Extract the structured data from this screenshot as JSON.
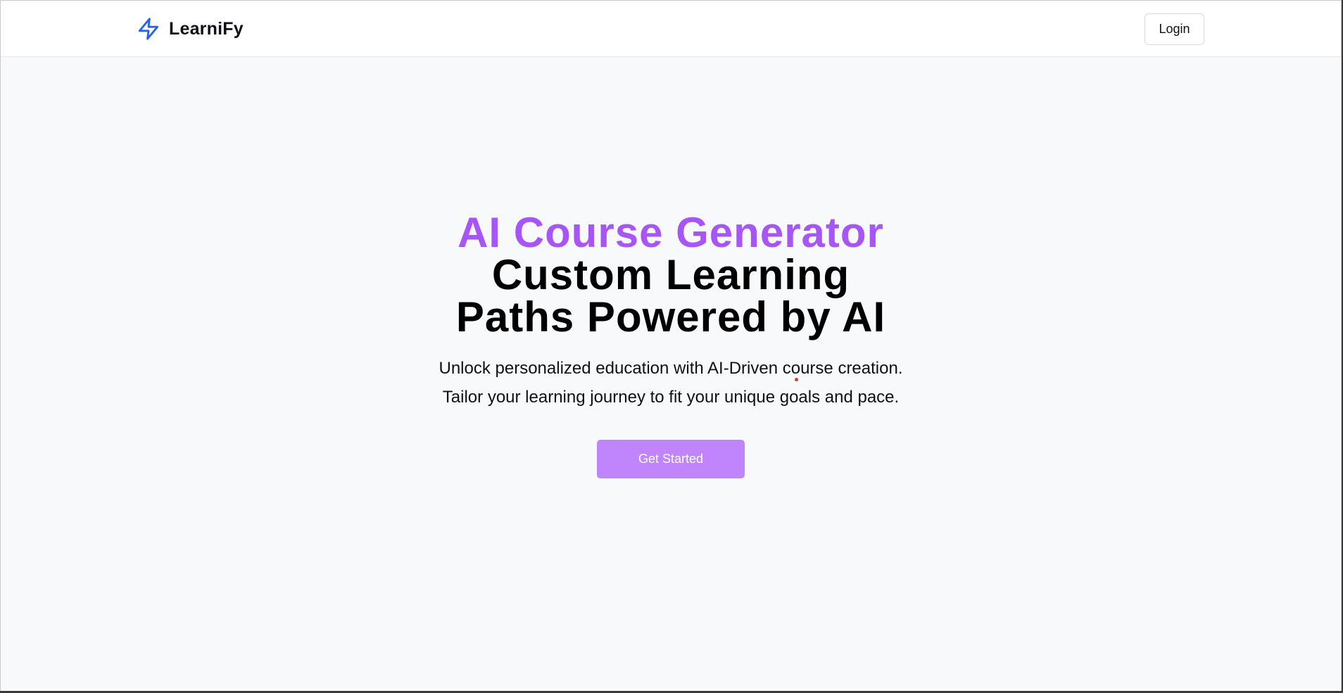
{
  "brand": {
    "name": "LearniFy",
    "icon": "lightning-bolt-icon",
    "icon_color": "#2563eb"
  },
  "nav": {
    "login_label": "Login"
  },
  "hero": {
    "title_accent": "AI Course Generator",
    "title_line1": "Custom Learning",
    "title_line2": "Paths Powered by AI",
    "subtitle_line1": "Unlock personalized education with AI-Driven course creation.",
    "subtitle_line2": "Tailor your learning journey to fit your unique goals and pace.",
    "cta_label": "Get Started"
  },
  "colors": {
    "accent": "#a855f7",
    "cta_background": "#c084fc",
    "page_background": "#f8f9fa"
  }
}
